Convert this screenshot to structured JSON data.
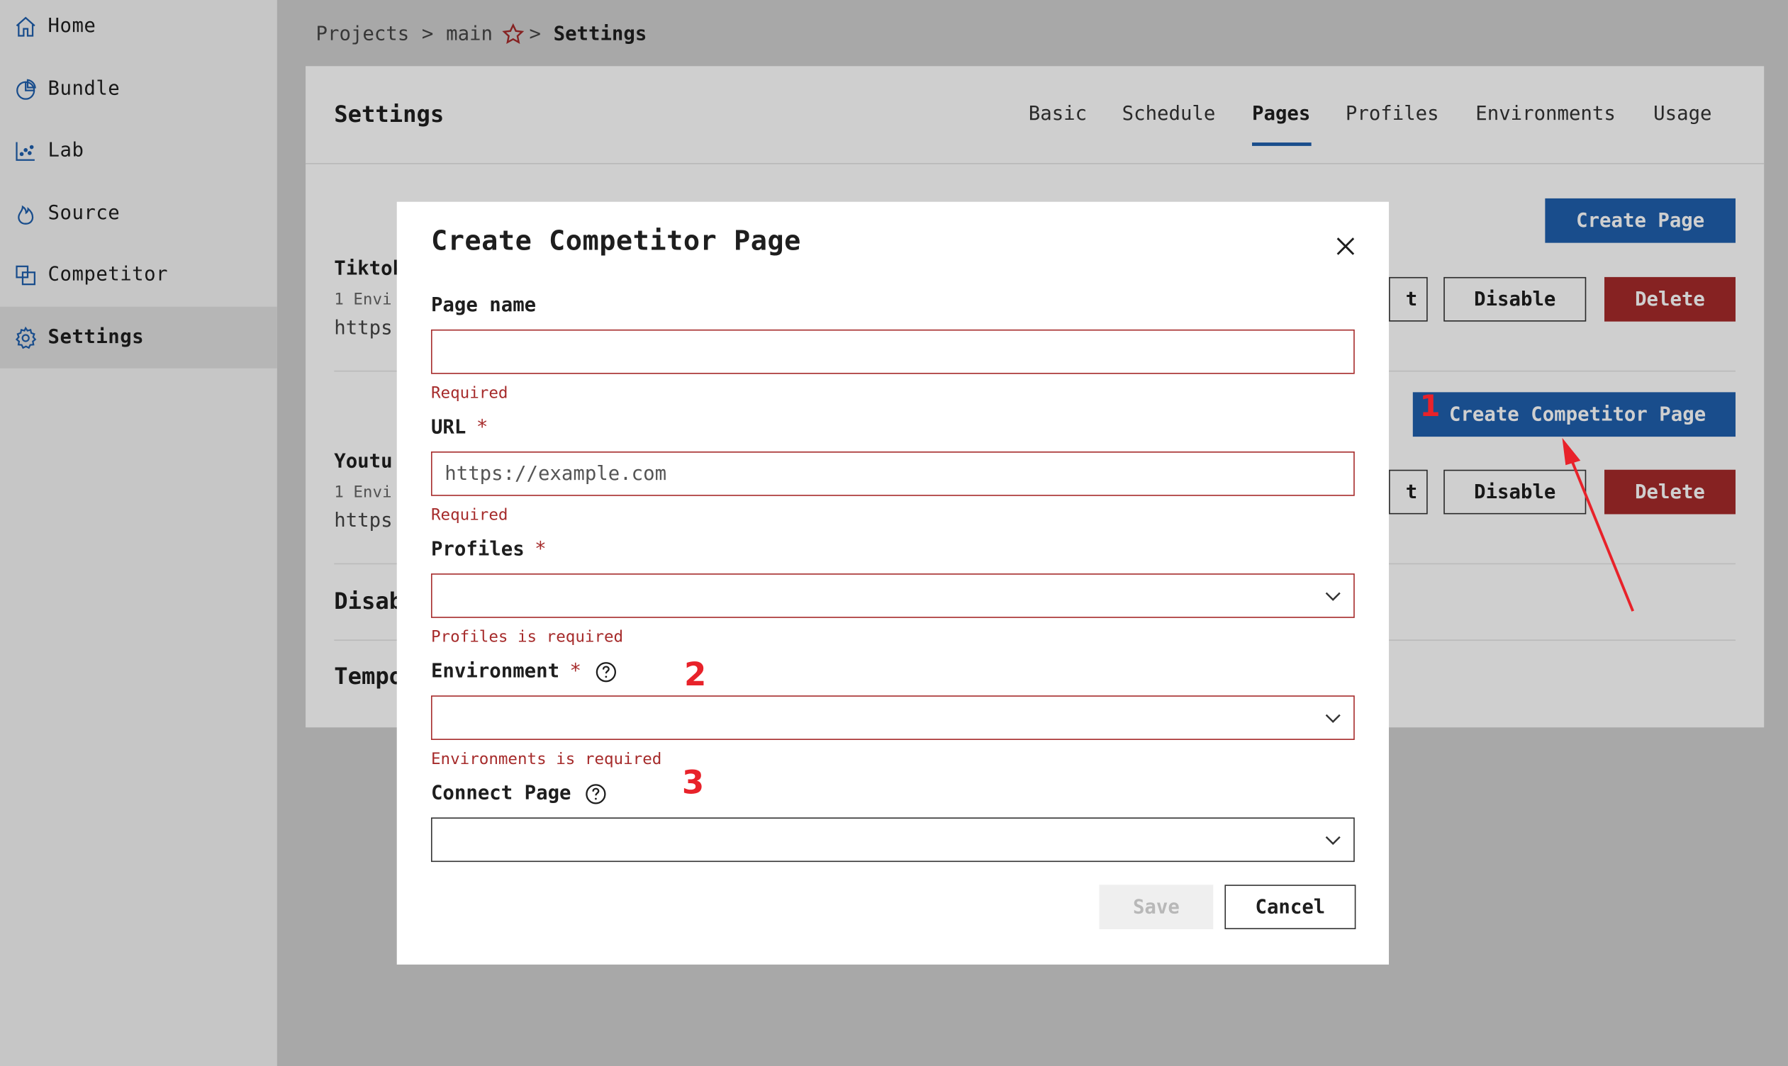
{
  "sidebar": {
    "items": [
      {
        "label": "Home",
        "icon": "home-icon",
        "active": false
      },
      {
        "label": "Bundle",
        "icon": "pie-chart-icon",
        "active": false
      },
      {
        "label": "Lab",
        "icon": "scatter-chart-icon",
        "active": false
      },
      {
        "label": "Source",
        "icon": "flame-icon",
        "active": false
      },
      {
        "label": "Competitor",
        "icon": "copy-icon",
        "active": false
      },
      {
        "label": "Settings",
        "icon": "gear-icon",
        "active": true
      }
    ]
  },
  "breadcrumb": {
    "items": [
      "Projects",
      "main",
      "Settings"
    ],
    "separator": ">"
  },
  "settings": {
    "title": "Settings",
    "tabs": [
      "Basic",
      "Schedule",
      "Pages",
      "Profiles",
      "Environments",
      "Usage"
    ],
    "active_tab": "Pages",
    "create_page_label": "Create Page",
    "create_competitor_label": "Create Competitor Page",
    "pages": [
      {
        "name": "Tiktok",
        "env": "1 Envi",
        "url": "https",
        "disable_label": "Disable",
        "delete_label": "Delete",
        "edit_label": "t"
      },
      {
        "name": "Youtu",
        "env": "1 Envi",
        "url": "https",
        "disable_label": "Disable",
        "delete_label": "Delete",
        "edit_label": "t"
      }
    ],
    "sections": [
      "Disab",
      "Tempo"
    ]
  },
  "modal": {
    "title": "Create Competitor Page",
    "fields": {
      "page_name": {
        "label": "Page name",
        "value": "",
        "error": "Required"
      },
      "url": {
        "label": "URL",
        "required_mark": "*",
        "placeholder": "https://example.com",
        "error": "Required"
      },
      "profiles": {
        "label": "Profiles",
        "required_mark": "*",
        "value": "",
        "error": "Profiles is required"
      },
      "environment": {
        "label": "Environment",
        "required_mark": "*",
        "value": "",
        "error": "Environments is required"
      },
      "connect_page": {
        "label": "Connect Page",
        "value": ""
      }
    },
    "save_label": "Save",
    "cancel_label": "Cancel"
  },
  "annotations": {
    "marker1": "1",
    "marker2": "2",
    "marker3": "3",
    "color": "#e8222a"
  },
  "colors": {
    "primary": "#1f5fad",
    "danger": "#a62b2b",
    "error_text": "#a62b2b"
  }
}
